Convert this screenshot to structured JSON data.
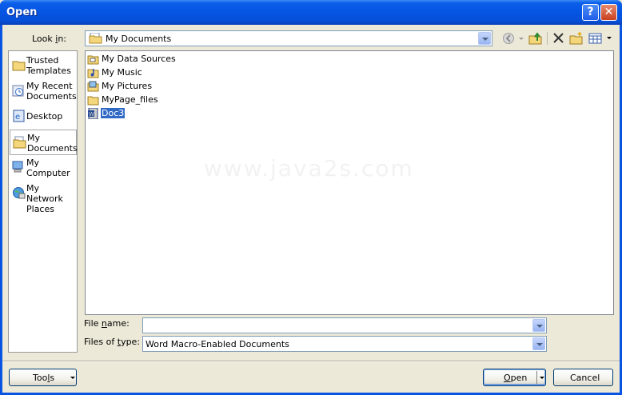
{
  "window": {
    "title": "Open",
    "help_glyph": "?",
    "close_glyph": "✕"
  },
  "lookin": {
    "label_pre": "Look ",
    "label_key": "i",
    "label_post": "n:",
    "value": "My Documents"
  },
  "toolbar": {
    "icons": [
      "back-icon",
      "up-folder-icon",
      "delete-icon",
      "new-folder-icon",
      "views-icon"
    ]
  },
  "places": [
    {
      "name": "trusted-templates",
      "label": "Trusted Templates"
    },
    {
      "name": "my-recent-documents",
      "label": "My Recent Documents"
    },
    {
      "name": "desktop",
      "label": "Desktop"
    },
    {
      "name": "my-documents",
      "label": "My Documents"
    },
    {
      "name": "my-computer",
      "label": "My Computer"
    },
    {
      "name": "my-network-places",
      "label": "My Network Places"
    }
  ],
  "files": [
    {
      "name": "My Data Sources",
      "icon": "data-folder-icon"
    },
    {
      "name": "My Music",
      "icon": "music-folder-icon"
    },
    {
      "name": "My Pictures",
      "icon": "pictures-folder-icon"
    },
    {
      "name": "MyPage_files",
      "icon": "folder-icon"
    },
    {
      "name": "Doc3",
      "icon": "word-document-icon"
    }
  ],
  "watermark": "www.java2s.com",
  "filename": {
    "label_pre": "File ",
    "label_key": "n",
    "label_post": "ame:",
    "value": ""
  },
  "filetype": {
    "label_pre": "Files of ",
    "label_key": "t",
    "label_post": "ype:",
    "value": "Word Macro-Enabled Documents"
  },
  "buttons": {
    "tools_pre": "Too",
    "tools_key": "l",
    "tools_post": "s",
    "open_pre": "",
    "open_key": "O",
    "open_post": "pen",
    "cancel": "Cancel"
  }
}
